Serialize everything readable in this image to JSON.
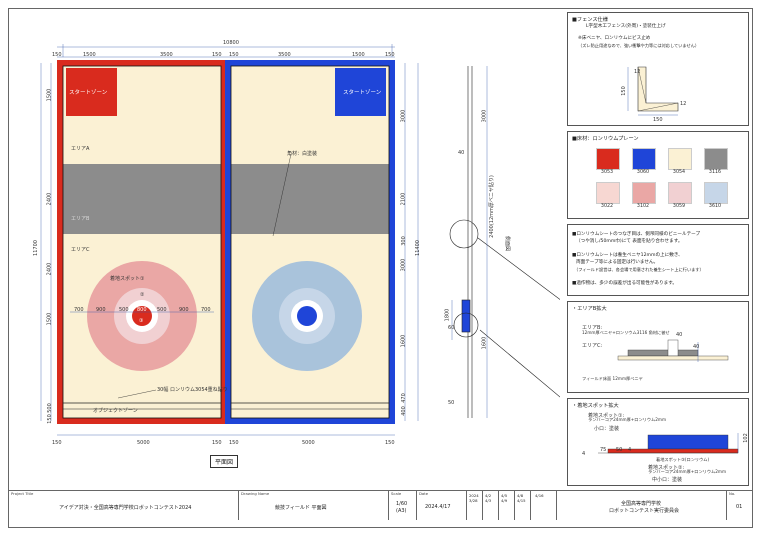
{
  "plan": {
    "overall_width": "10800",
    "left_field": {
      "start_zone": "スタートゾーン",
      "area_a": "エリアA",
      "area_b": "エリアB",
      "area_c": "エリアC",
      "landing_spot": "着地スポット①",
      "ring2": "②",
      "ring3": "③",
      "object_zone": "オブジェクトゾーン",
      "tape_note": "30幅 ロンリウム3054重ね貼り"
    },
    "right_field": {
      "start_zone": "スタートゾーン",
      "corner_note": "角材：白塗装"
    },
    "top_dims": [
      "150",
      "1500",
      "3500",
      "150",
      "150",
      "3500",
      "1500",
      "150"
    ],
    "bottom_dims": [
      "150",
      "5000",
      "150",
      "150",
      "5000",
      "150"
    ],
    "ring_dims": [
      "700",
      "900",
      "500",
      "800",
      "500",
      "900",
      "700"
    ],
    "left_dims": [
      "1500",
      "2400",
      "2400",
      "1500",
      "500",
      "150"
    ],
    "total_height": "11700",
    "right_dims": [
      "3000",
      "2100",
      "2400",
      "300",
      "300",
      "2100",
      "3000",
      "1600",
      "470",
      "400",
      "150"
    ],
    "right_total": "11400",
    "caption": "平面図",
    "side_view_label": "側面図",
    "side_dims": [
      "3000",
      "2400(12mm厚ベニヤ貼り)",
      "40",
      "1600",
      "1800",
      "60",
      "50"
    ]
  },
  "panels": {
    "fence": {
      "title": "■フェンス仕様",
      "lines": [
        "L字型木工フェンス(外周)・塗装仕上げ",
        "※床ベニヤ、ロンリウムにビス止め",
        "（ズレ防止用途なので、強い衝撃や力等には対応していません）"
      ],
      "dims": [
        "150",
        "150",
        "12",
        "12"
      ]
    },
    "floor": {
      "title": "■床材：ロンリウムプレーン",
      "swatches": [
        {
          "code": "3053",
          "color": "#d92b1e"
        },
        {
          "code": "3060",
          "color": "#1f45d8"
        },
        {
          "code": "3054",
          "color": "#fbf1d4"
        },
        {
          "code": "3116",
          "color": "#8c8c8c"
        },
        {
          "code": "3022",
          "color": "#f7d7d2"
        },
        {
          "code": "3102",
          "color": "#eaa7a5"
        },
        {
          "code": "3059",
          "color": "#f1d0d2"
        },
        {
          "code": "3610",
          "color": "#c6d6e8"
        }
      ]
    },
    "notes": {
      "lines": [
        "■ロンリウムシートのつなぎ目は、側吊同様のビニールテープ",
        "（つや消し/50mm巾)にて 表面を貼り合わせます。",
        "■ロンリウムシートは養生ベニヤ12mmの上に敷き、",
        "  両面テープ等による固定は行いません。",
        "（フィールド設営は、各会場で用意された養生シート上に行います）",
        "■過作物は、多少の誤差が出る可能性があります。"
      ]
    },
    "area_b": {
      "title": "・エリアB拡大",
      "labels": [
        "エリアB:",
        "12mm厚ベニヤ+ロンリウム3116 角材に被せ",
        "エリアC:",
        "フィールド床面 12mm厚ベニヤ"
      ],
      "dims": [
        "40",
        "40"
      ]
    },
    "landing": {
      "title": "・着地スポット拡大",
      "labels": [
        "着地スポット①:",
        "ランバーコア24mm厚+ロンリウム2mm",
        "小ロ：塗装",
        "着地スポット③(ロンリウム)",
        "着地スポット②:",
        "ランバーコア24mm厚+ロンリウム2mm",
        "中小ロ：塗装"
      ],
      "dims": [
        "102",
        "4",
        "75",
        "50",
        "4"
      ]
    }
  },
  "title_block": {
    "project_title_label": "Project Title",
    "project_title": "アイデア対決・全国高等専門学校ロボットコンテスト2024",
    "drawing_name_label": "Drawing Name",
    "drawing_name": "競技フィールド 平面図",
    "scale_label": "Scale",
    "scale": "1/60",
    "paper": "(A3)",
    "date_label": "Date",
    "date": "2024.4/17",
    "revisions": [
      "2024 3/28",
      "4/2 4/3",
      "4/5 4/9",
      "4/8 4/15",
      "4/16"
    ],
    "org": "全国高等専門学校",
    "org2": "ロボットコンテスト実行委員会",
    "no_label": "No.",
    "no": "01"
  }
}
